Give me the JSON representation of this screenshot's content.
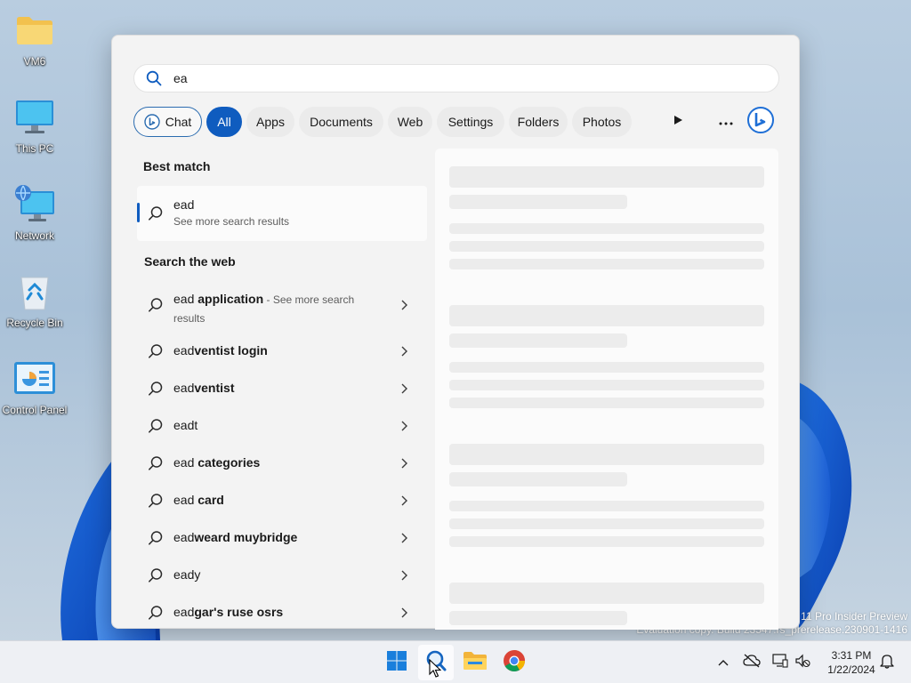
{
  "desktop": {
    "icons": [
      {
        "label": "VM6",
        "icon": "folder-icon"
      },
      {
        "label": "This PC",
        "icon": "monitor-icon"
      },
      {
        "label": "Network",
        "icon": "network-icon"
      },
      {
        "label": "Recycle Bin",
        "icon": "recycle-bin-icon"
      },
      {
        "label": "Control Panel",
        "icon": "control-panel-icon"
      }
    ],
    "watermark": {
      "line1": "11 Pro Insider Preview",
      "line2": "Evaluation copy. Build 23547.rs_prerelease.230901-1416"
    }
  },
  "search": {
    "query": "ea",
    "filters": {
      "chat": "Chat",
      "all": "All",
      "apps": "Apps",
      "documents": "Documents",
      "web": "Web",
      "settings": "Settings",
      "folders": "Folders",
      "photos": "Photos"
    },
    "best_match_title": "Best match",
    "best_match": {
      "title": "ead",
      "subtitle": "See more search results"
    },
    "web_title": "Search the web",
    "web_results": [
      {
        "prefix": "ead",
        "bold": " application",
        "suffix": " - See more search results"
      },
      {
        "prefix": "ead",
        "bold": "ventist login",
        "suffix": ""
      },
      {
        "prefix": "ead",
        "bold": "ventist",
        "suffix": ""
      },
      {
        "prefix": "eadt",
        "bold": "",
        "suffix": ""
      },
      {
        "prefix": "ead",
        "bold": " categories",
        "suffix": ""
      },
      {
        "prefix": "ead",
        "bold": " card",
        "suffix": ""
      },
      {
        "prefix": "ead",
        "bold": "weard muybridge",
        "suffix": ""
      },
      {
        "prefix": "eady",
        "bold": "",
        "suffix": ""
      },
      {
        "prefix": "ead",
        "bold": "gar's ruse osrs",
        "suffix": ""
      }
    ]
  },
  "taskbar": {
    "time": "3:31 PM",
    "date": "1/22/2024"
  },
  "colors": {
    "accent": "#0f5cbf",
    "panel": "#f3f3f3"
  }
}
